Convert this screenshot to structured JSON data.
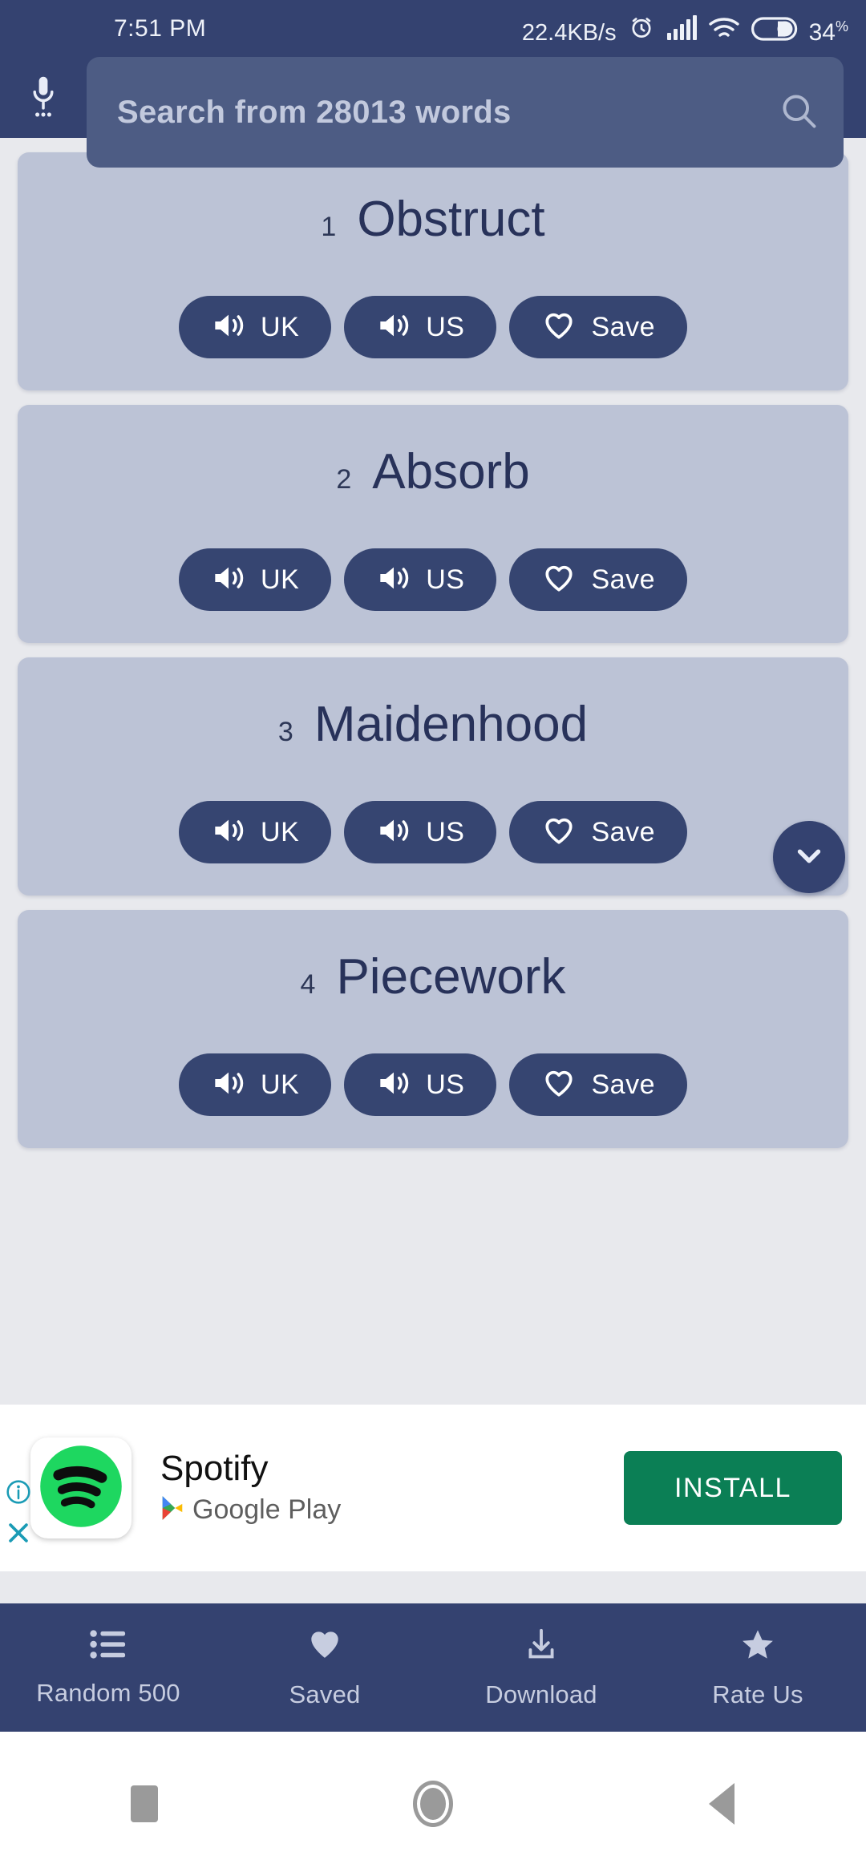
{
  "status_bar": {
    "time": "7:51 PM",
    "network_speed": "22.4KB/s",
    "battery_percent": "34",
    "battery_unit": "%",
    "icons": [
      "alarm-clock-icon",
      "signal-bars-icon",
      "wifi-icon",
      "battery-icon"
    ]
  },
  "app_bar": {
    "mic_icon": "microphone-icon",
    "search_icon": "search-icon",
    "search_placeholder": "Search from 28013 words",
    "search_value": ""
  },
  "theme": {
    "header_navy": "#344270",
    "search_field": "#4d5c84",
    "card_bg": "#bcc3d6",
    "page_bg": "#e8e9ed",
    "pill_navy": "#364571",
    "word_text": "#28325a",
    "install_green": "#0b7f55",
    "ad_badge_teal": "#1a9bb5"
  },
  "word_list": {
    "buttons": {
      "uk_label": "UK",
      "us_label": "US",
      "save_label": "Save",
      "speaker_icon": "speaker-volume-icon",
      "heart_icon": "heart-outline-icon"
    },
    "items": [
      {
        "index": "1",
        "word": "Obstruct"
      },
      {
        "index": "2",
        "word": "Absorb"
      },
      {
        "index": "3",
        "word": "Maidenhood"
      },
      {
        "index": "4",
        "word": "Piecework"
      }
    ]
  },
  "scroll_fab": {
    "icon": "chevron-down-icon"
  },
  "ad": {
    "info_icon": "info-circle-icon",
    "close_icon": "close-icon",
    "app_icon": "spotify-logo-icon",
    "title": "Spotify",
    "store_icon": "google-play-icon",
    "store_name": "Google Play",
    "cta_label": "INSTALL"
  },
  "bottom_nav": {
    "items": [
      {
        "label": "Random 500",
        "icon": "list-icon"
      },
      {
        "label": "Saved",
        "icon": "heart-filled-icon"
      },
      {
        "label": "Download",
        "icon": "download-icon"
      },
      {
        "label": "Rate Us",
        "icon": "star-icon"
      }
    ]
  },
  "system_nav": {
    "recents": "square-recents-icon",
    "home": "circle-home-icon",
    "back": "triangle-back-icon"
  }
}
